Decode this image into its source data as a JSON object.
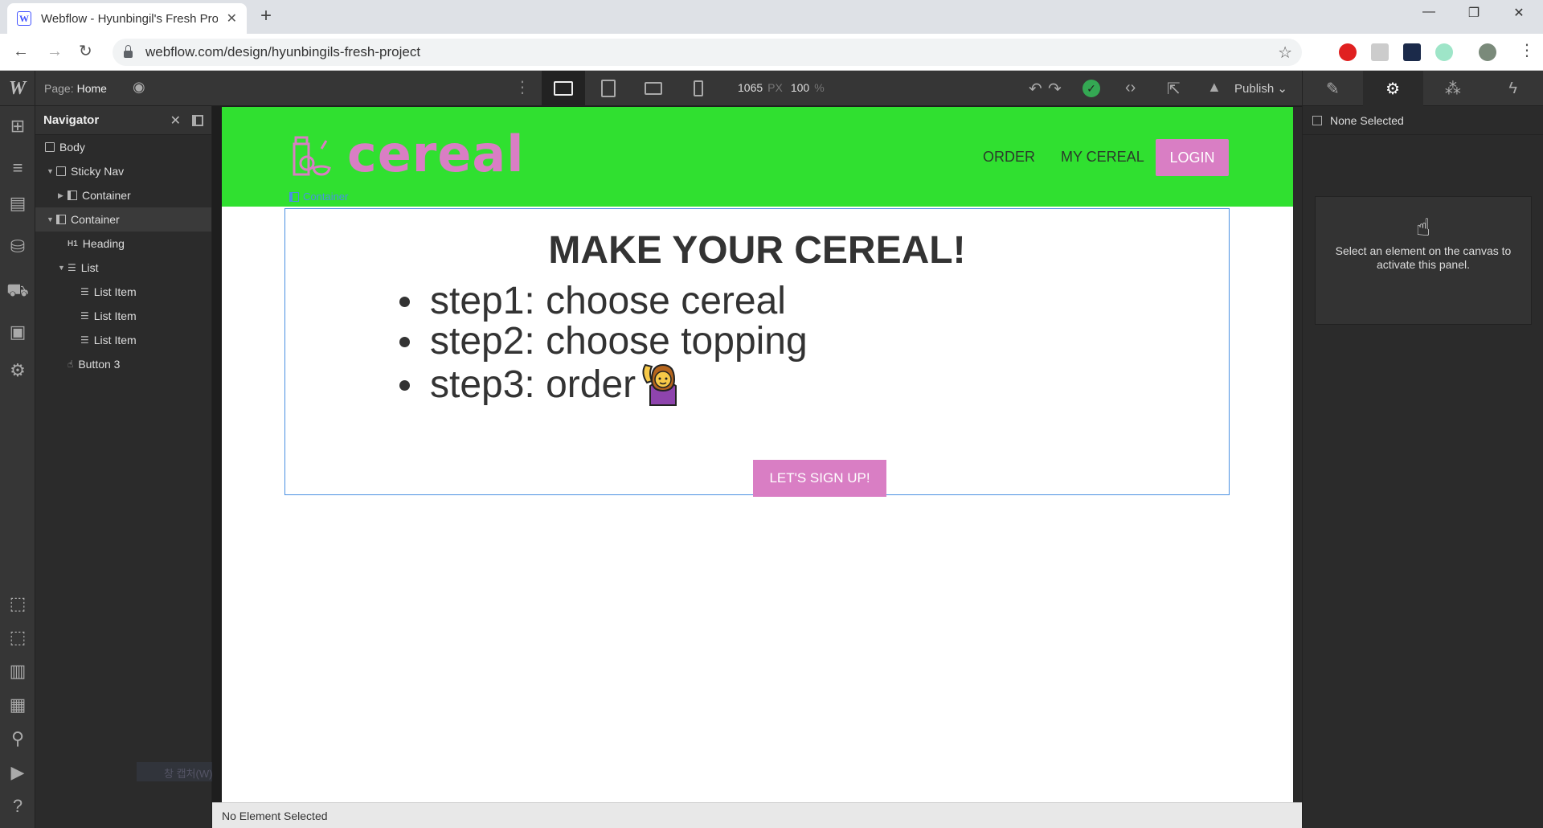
{
  "browser": {
    "tab_title": "Webflow - Hyunbingil's Fresh Project",
    "favicon": "W",
    "new_tab": "+",
    "url": "webflow.com/design/hyunbingils-fresh-project",
    "window": {
      "minimize": "—",
      "maximize": "❐",
      "close": "✕"
    }
  },
  "toolbar": {
    "page_label": "Page:",
    "page_name": "Home",
    "width_value": "1065",
    "width_unit": "PX",
    "zoom_value": "100",
    "zoom_unit": "%",
    "publish_label": "Publish"
  },
  "navigator": {
    "title": "Navigator",
    "items": [
      {
        "label": "Body"
      },
      {
        "label": "Sticky Nav"
      },
      {
        "label": "Container"
      },
      {
        "label": "Container"
      },
      {
        "label": "Heading",
        "icon_text": "H1"
      },
      {
        "label": "List"
      },
      {
        "label": "List Item"
      },
      {
        "label": "List Item"
      },
      {
        "label": "List Item"
      },
      {
        "label": "Button 3"
      }
    ],
    "ghost_text": "창 캡처(W)"
  },
  "site": {
    "logo_text": "cereal",
    "nav_links": [
      "ORDER",
      "MY CEREAL"
    ],
    "login_label": "LOGIN",
    "container_tag": "Container",
    "heading": "MAKE YOUR CEREAL!",
    "steps": [
      "step1: choose cereal",
      "step2: choose topping",
      "step3: order"
    ],
    "signup_label": "LET'S SIGN UP!",
    "colors": {
      "nav_bg": "#30e030",
      "accent": "#d97ec4"
    }
  },
  "status": {
    "text": "No Element Selected"
  },
  "right_panel": {
    "none_selected": "None Selected",
    "hint": "Select an element on the canvas to activate this panel."
  }
}
